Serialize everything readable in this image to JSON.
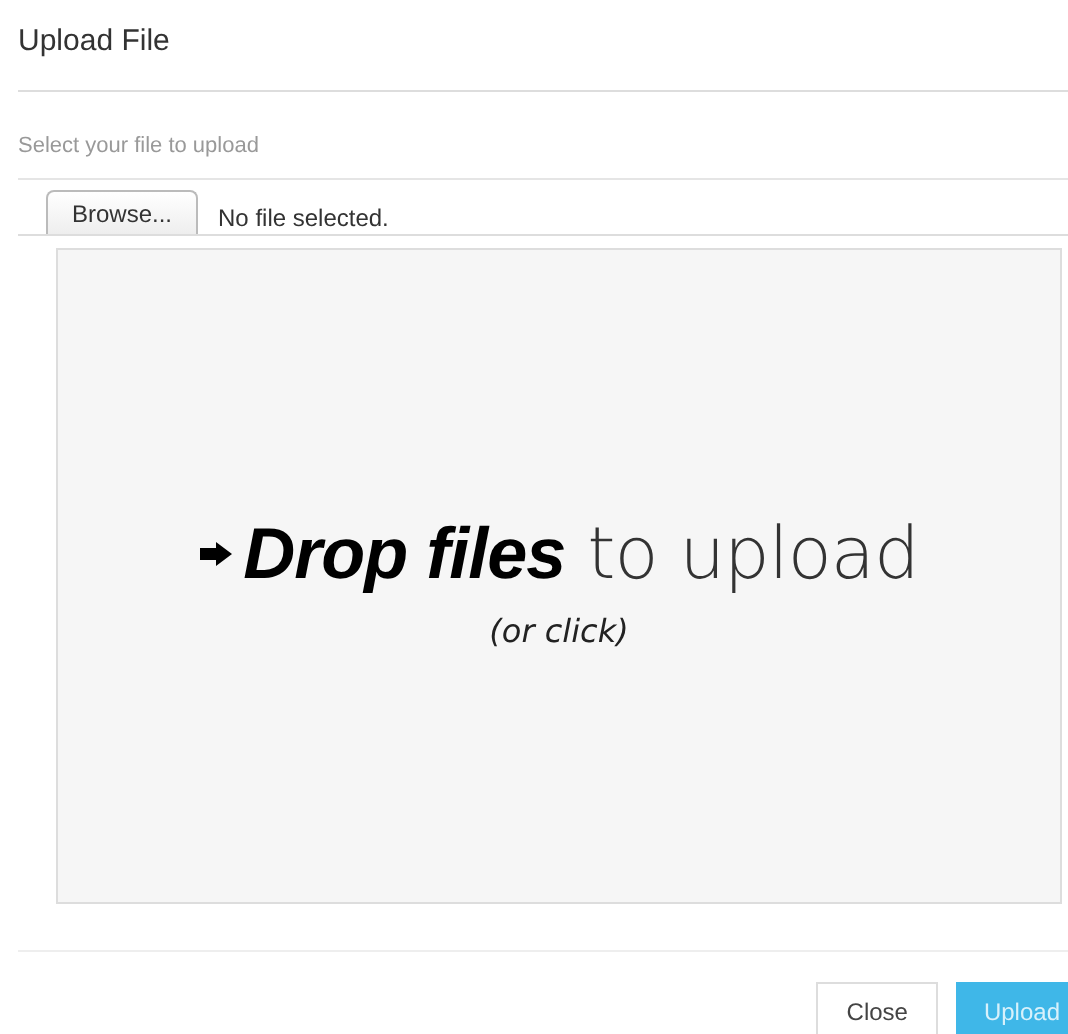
{
  "dialog": {
    "title": "Upload File"
  },
  "file_input": {
    "label": "Select your file to upload",
    "button": "Browse...",
    "status": "No file selected."
  },
  "dropzone": {
    "message": "**Drop files** to upload",
    "hint": "(or click)"
  },
  "buttons": [
    {
      "label": "Close",
      "kind": "default"
    },
    {
      "label": "Upload",
      "kind": "primary"
    }
  ]
}
